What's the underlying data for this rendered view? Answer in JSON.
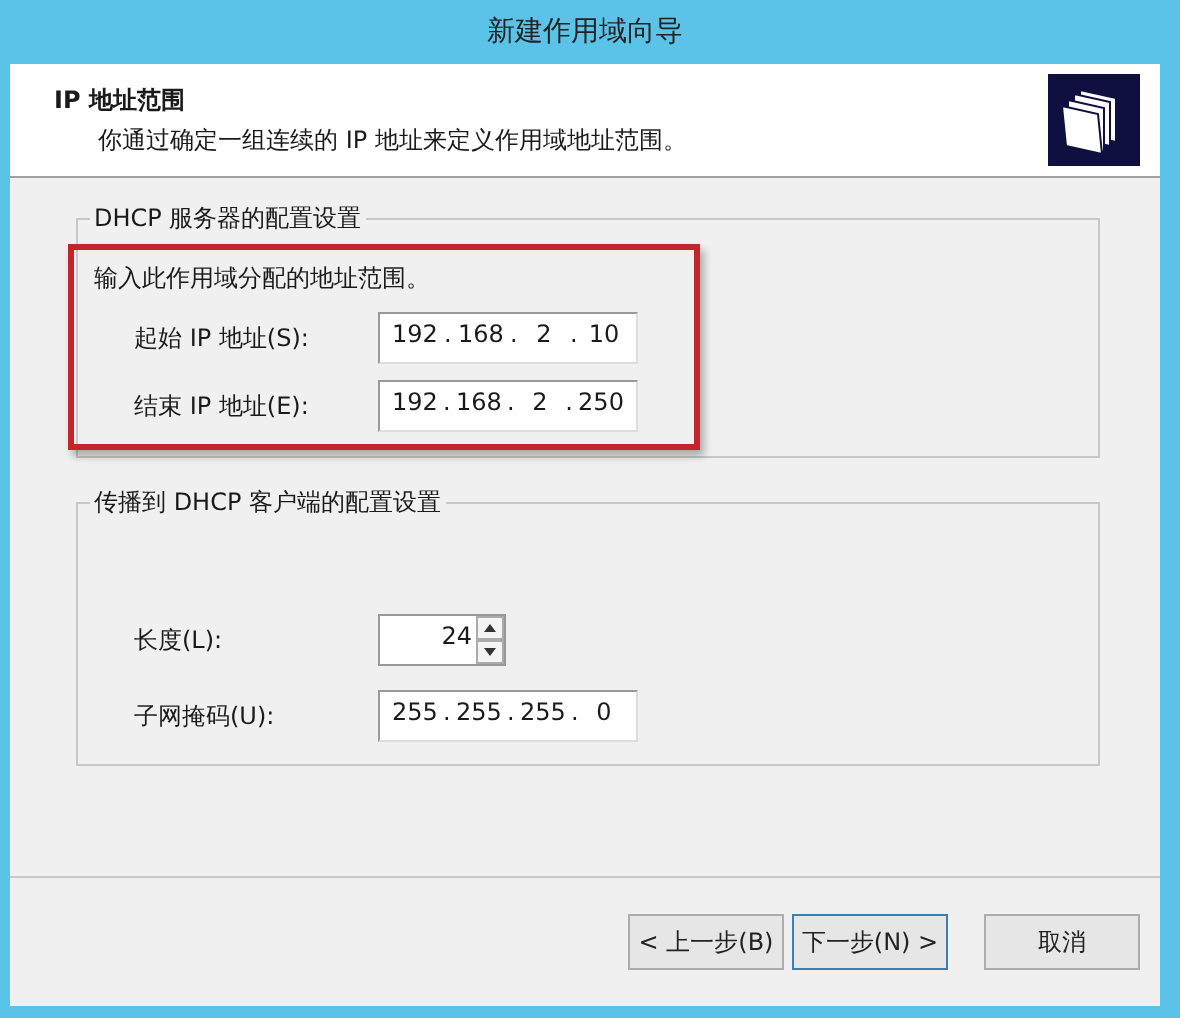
{
  "window": {
    "title": "新建作用域向导"
  },
  "header": {
    "title": "IP 地址范围",
    "description": "你通过确定一组连续的 IP 地址来定义作用域地址范围。"
  },
  "groups": [
    {
      "legend": "DHCP 服务器的配置设置",
      "highlighted": true,
      "intro": "输入此作用域分配的地址范围。",
      "fields": [
        {
          "kind": "ip",
          "label": "起始 IP 地址(S):",
          "octets": [
            "192",
            "168",
            "2",
            "10"
          ]
        },
        {
          "kind": "ip",
          "label": "结束 IP 地址(E):",
          "octets": [
            "192",
            "168",
            "2",
            "250"
          ]
        }
      ]
    },
    {
      "legend": "传播到 DHCP 客户端的配置设置",
      "highlighted": false,
      "fields": [
        {
          "kind": "spin",
          "label": "长度(L):",
          "value": "24"
        },
        {
          "kind": "ip",
          "label": "子网掩码(U):",
          "octets": [
            "255",
            "255",
            "255",
            "0"
          ]
        }
      ]
    }
  ],
  "ip_separator": ".",
  "buttons": [
    {
      "label": "< 上一步(B)",
      "default": false
    },
    {
      "label": "下一步(N) >",
      "default": true
    },
    {
      "label": "取消",
      "default": false
    }
  ]
}
